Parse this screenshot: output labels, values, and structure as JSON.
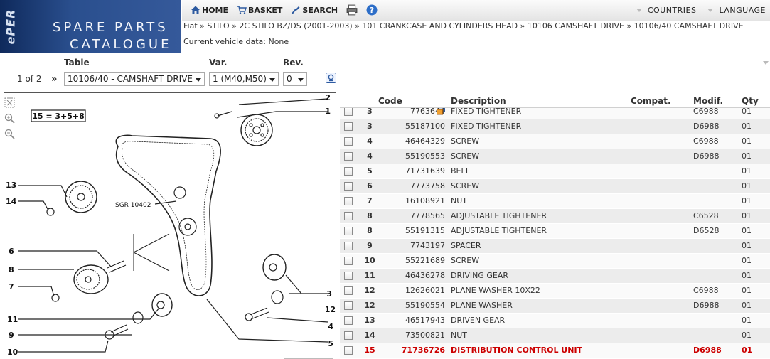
{
  "logo": {
    "brand": "ePER",
    "line1": "SPARE PARTS",
    "line2": "CATALOGUE"
  },
  "nav": {
    "home": "HOME",
    "basket": "BASKET",
    "search": "SEARCH",
    "countries": "COUNTRIES",
    "language": "LANGUAGE"
  },
  "breadcrumb": "Fiat » STILO » 2C STILO BZ/DS (2001-2003) » 101 CRANKCASE AND CYLINDERS HEAD » 10106 CAMSHAFT DRIVE » 10106/40 CAMSHAFT DRIVE",
  "vehicle_data": "Current vehicle data: None",
  "selectors": {
    "table_label": "Table",
    "var_label": "Var.",
    "rev_label": "Rev.",
    "pager": "1 of 2",
    "pager_next": "»",
    "table_value": "10106/40 - CAMSHAFT DRIVE",
    "var_value": "1 (M40,M50)",
    "rev_value": "0"
  },
  "drawing": {
    "formula": "15 = 3+5+8",
    "sgr_label": "SGR 10402",
    "callouts": [
      "1",
      "2",
      "3",
      "4",
      "5",
      "6",
      "7",
      "8",
      "9",
      "10",
      "11",
      "12",
      "13",
      "14"
    ]
  },
  "table": {
    "headers": {
      "code": "Code",
      "description": "Description",
      "compat": "Compat.",
      "modif": "Modif.",
      "qty": "Qty"
    },
    "rows": [
      {
        "ref": "3",
        "code": "7763644",
        "desc": "FIXED TIGHTENER",
        "modif": "C6988",
        "qty": "01",
        "icon": true
      },
      {
        "ref": "3",
        "code": "55187100",
        "desc": "FIXED TIGHTENER",
        "modif": "D6988",
        "qty": "01"
      },
      {
        "ref": "4",
        "code": "46464329",
        "desc": "SCREW",
        "modif": "C6988",
        "qty": "01"
      },
      {
        "ref": "4",
        "code": "55190553",
        "desc": "SCREW",
        "modif": "D6988",
        "qty": "01"
      },
      {
        "ref": "5",
        "code": "71731639",
        "desc": "BELT",
        "modif": "",
        "qty": "01"
      },
      {
        "ref": "6",
        "code": "7773758",
        "desc": "SCREW",
        "modif": "",
        "qty": "01"
      },
      {
        "ref": "7",
        "code": "16108921",
        "desc": "NUT",
        "modif": "",
        "qty": "01"
      },
      {
        "ref": "8",
        "code": "7778565",
        "desc": "ADJUSTABLE TIGHTENER",
        "modif": "C6528",
        "qty": "01"
      },
      {
        "ref": "8",
        "code": "55191315",
        "desc": "ADJUSTABLE TIGHTENER",
        "modif": "D6528",
        "qty": "01"
      },
      {
        "ref": "9",
        "code": "7743197",
        "desc": "SPACER",
        "modif": "",
        "qty": "01"
      },
      {
        "ref": "10",
        "code": "55221689",
        "desc": "SCREW",
        "modif": "",
        "qty": "01"
      },
      {
        "ref": "11",
        "code": "46436278",
        "desc": "DRIVING GEAR",
        "modif": "",
        "qty": "01"
      },
      {
        "ref": "12",
        "code": "12626021",
        "desc": "PLANE WASHER 10X22",
        "modif": "C6988",
        "qty": "01"
      },
      {
        "ref": "12",
        "code": "55190554",
        "desc": "PLANE WASHER",
        "modif": "D6988",
        "qty": "01"
      },
      {
        "ref": "13",
        "code": "46517943",
        "desc": "DRIVEN GEAR",
        "modif": "",
        "qty": "01"
      },
      {
        "ref": "14",
        "code": "73500821",
        "desc": "NUT",
        "modif": "",
        "qty": "01"
      },
      {
        "ref": "15",
        "code": "71736726",
        "desc": "DISTRIBUTION CONTROL UNIT",
        "modif": "D6988",
        "qty": "01",
        "highlight": true
      }
    ]
  },
  "colors": {
    "logo_bg": "#2a4f8e",
    "highlight": "#cc0000",
    "row_alt": "#ececec"
  }
}
